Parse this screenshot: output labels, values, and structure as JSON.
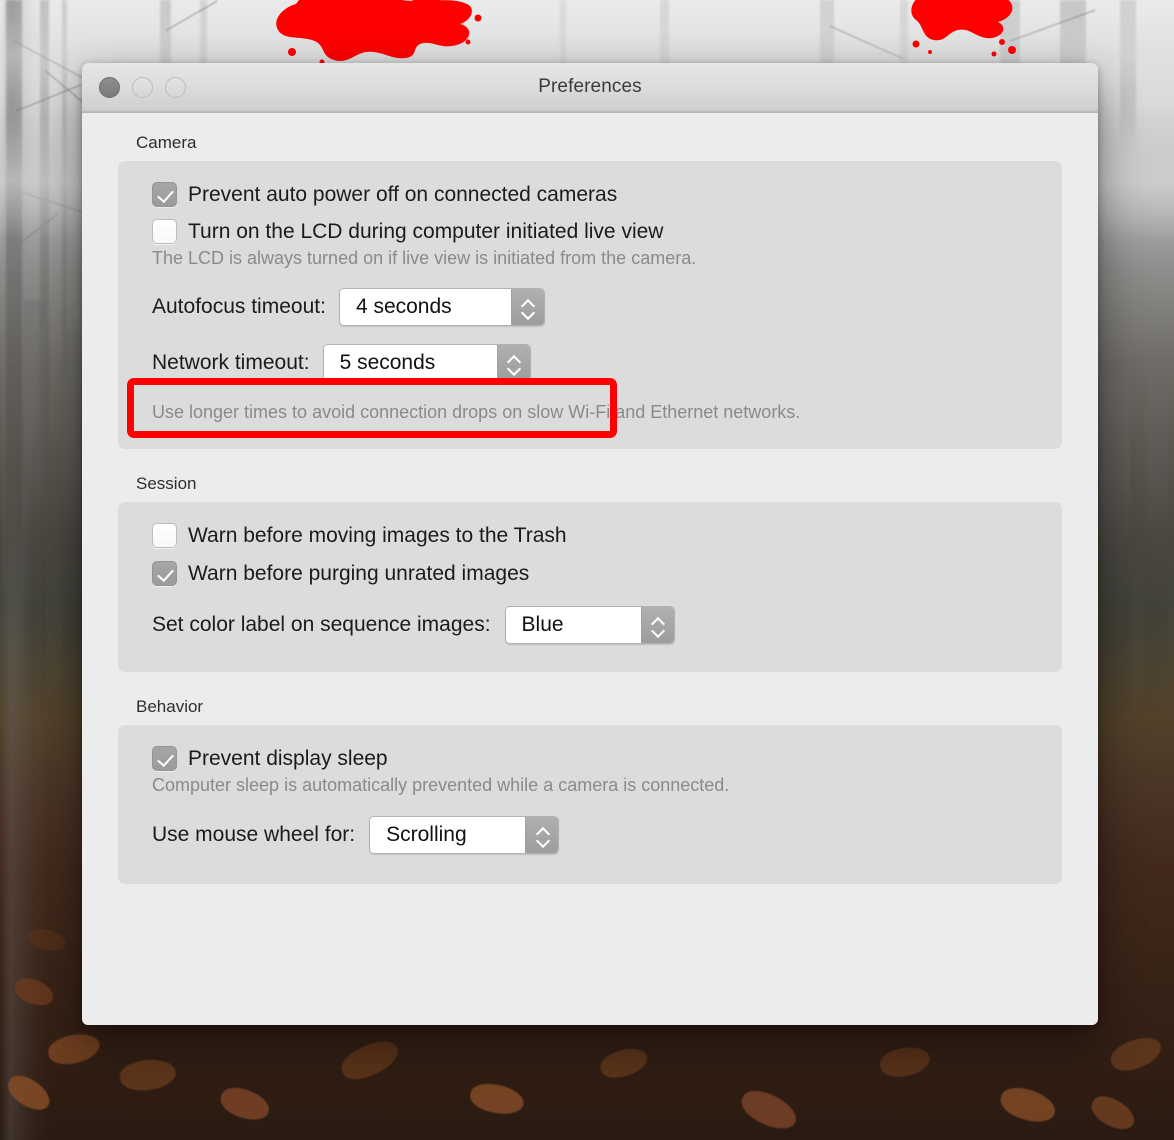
{
  "window": {
    "title": "Preferences",
    "traffic_lights": [
      "close",
      "minimize",
      "zoom"
    ]
  },
  "sections": {
    "camera": {
      "label": "Camera",
      "checkbox_prevent_power_off": {
        "label": "Prevent auto power off on connected cameras",
        "checked": true
      },
      "checkbox_lcd_live_view": {
        "label": "Turn on the LCD during computer initiated live view",
        "checked": false
      },
      "hint_lcd": "The LCD is always turned on if live view is initiated from the camera.",
      "autofocus_timeout": {
        "label": "Autofocus timeout:",
        "value": "4 seconds"
      },
      "network_timeout": {
        "label": "Network timeout:",
        "value": "5 seconds"
      },
      "hint_network": "Use longer times to avoid connection drops on slow Wi-Fi and Ethernet networks."
    },
    "session": {
      "label": "Session",
      "checkbox_warn_trash": {
        "label": "Warn before moving images to the Trash",
        "checked": false
      },
      "checkbox_warn_purge": {
        "label": "Warn before purging unrated images",
        "checked": true
      },
      "color_label": {
        "label": "Set color label on sequence images:",
        "value": "Blue"
      }
    },
    "behavior": {
      "label": "Behavior",
      "checkbox_prevent_display_sleep": {
        "label": "Prevent display sleep",
        "checked": true
      },
      "hint_sleep": "Computer sleep is automatically prevented while a camera is connected.",
      "mouse_wheel": {
        "label": "Use mouse wheel for:",
        "value": "Scrolling"
      }
    }
  },
  "annotation": {
    "highlight_color": "#ff0000",
    "target": "Network timeout row"
  },
  "colors": {
    "window_background": "#ececec",
    "panel_background": "#dcdcdc",
    "titlebar": "#dcdcdc",
    "text_primary": "#1b1b1b",
    "text_hint": "#8a8a8a",
    "stepper_button": "#a6a6a6"
  }
}
